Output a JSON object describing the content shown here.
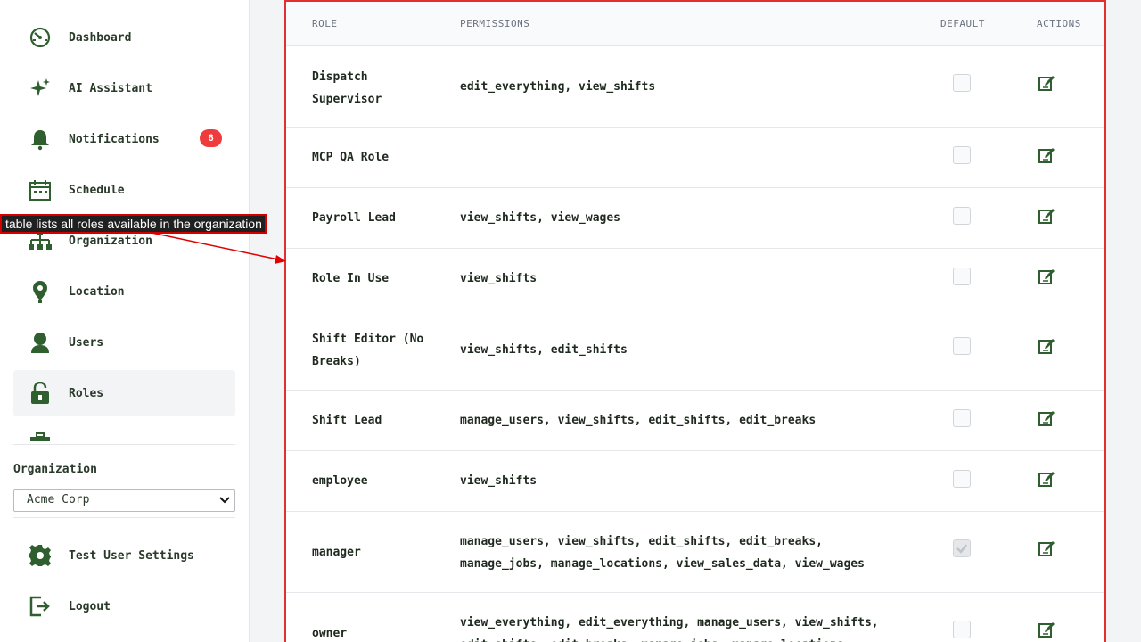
{
  "sidebar": {
    "items": [
      {
        "label": "Dashboard",
        "icon": "dashboard-icon"
      },
      {
        "label": "AI Assistant",
        "icon": "sparkle-icon"
      },
      {
        "label": "Notifications",
        "icon": "bell-icon",
        "badge": "6"
      },
      {
        "label": "Schedule",
        "icon": "calendar-icon"
      },
      {
        "label": "Organization",
        "icon": "org-chart-icon"
      },
      {
        "label": "Location",
        "icon": "map-pin-icon"
      },
      {
        "label": "Users",
        "icon": "user-icon"
      },
      {
        "label": "Roles",
        "icon": "unlock-icon",
        "active": true
      }
    ],
    "organization_label": "Organization",
    "organization_selected": "Acme Corp",
    "test_user_settings": "Test User Settings",
    "logout": "Logout"
  },
  "annotation": {
    "text": "table lists all roles available in the organization"
  },
  "table": {
    "headers": {
      "role": "ROLE",
      "permissions": "PERMISSIONS",
      "default": "DEFAULT",
      "actions": "ACTIONS"
    },
    "rows": [
      {
        "role": "Dispatch Supervisor",
        "permissions": "edit_everything, view_shifts",
        "default": false
      },
      {
        "role": "MCP QA Role",
        "permissions": "",
        "default": false
      },
      {
        "role": "Payroll Lead",
        "permissions": "view_shifts, view_wages",
        "default": false
      },
      {
        "role": "Role In Use",
        "permissions": "view_shifts",
        "default": false
      },
      {
        "role": "Shift Editor (No Breaks)",
        "permissions": "view_shifts, edit_shifts",
        "default": false
      },
      {
        "role": "Shift Lead",
        "permissions": "manage_users, view_shifts, edit_shifts, edit_breaks",
        "default": false
      },
      {
        "role": "employee",
        "permissions": "view_shifts",
        "default": false
      },
      {
        "role": "manager",
        "permissions": "manage_users, view_shifts, edit_shifts, edit_breaks, manage_jobs, manage_locations, view_sales_data, view_wages",
        "default": true
      },
      {
        "role": "owner",
        "permissions": "view_everything, edit_everything, manage_users, view_shifts, edit_shifts, edit_breaks, manage_jobs, manage_locations",
        "default": false
      }
    ]
  },
  "colors": {
    "accent": "#2f5f2f",
    "badge": "#ef3b3b",
    "annotation_border": "#d40000",
    "table_border": "#e03030"
  }
}
